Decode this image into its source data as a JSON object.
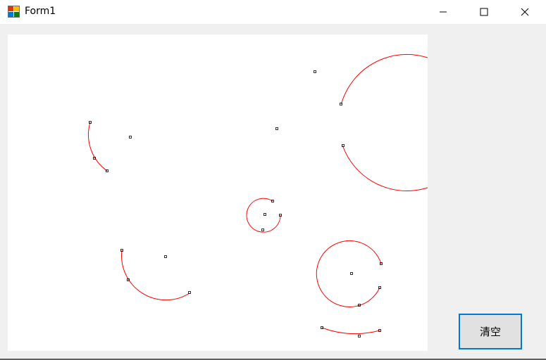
{
  "window": {
    "title": "Form1",
    "icon": "winforms-app-icon",
    "controls": [
      "minimize-icon",
      "maximize-icon",
      "close-icon"
    ]
  },
  "canvas": {
    "stroke_color": "#ff0000",
    "point_color": "#000000",
    "background": "#ffffff"
  },
  "clear_button": {
    "label": "清空",
    "border_color": "#0078d7"
  }
}
